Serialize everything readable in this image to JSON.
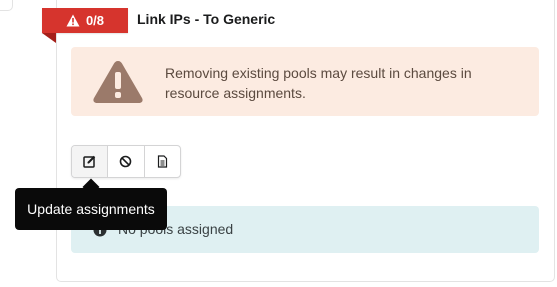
{
  "ribbon": {
    "count": "0/8",
    "color": "#d6342d",
    "icon": "warning-triangle-icon"
  },
  "title": "Link IPs - To Generic",
  "warning": {
    "message": "Removing existing pools may result in changes in resource assignments.",
    "icon": "warning-icon",
    "background": "#fcebe1"
  },
  "toolbar": {
    "buttons": [
      {
        "icon": "edit-icon"
      },
      {
        "icon": "ban-icon"
      },
      {
        "icon": "document-icon"
      }
    ]
  },
  "tooltip": {
    "text": "Update assignments"
  },
  "info": {
    "message": "No pools assigned",
    "icon": "info-icon",
    "background": "#dff0f2"
  }
}
